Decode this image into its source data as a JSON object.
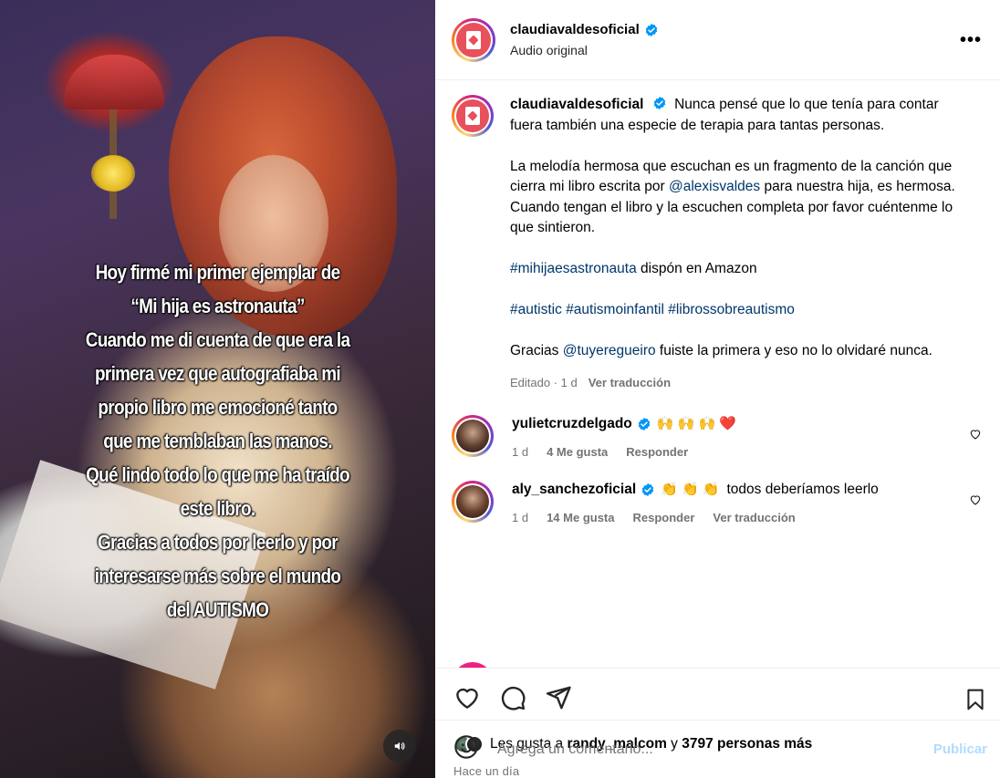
{
  "media": {
    "overlay_text": "Hoy firmé mi primer ejemplar de\n“Mi hija es astronauta”\nCuando me di cuenta de que era la\nprimera vez que autografiaba mi\npropio libro me emocioné tanto\nque me temblaban las manos.\nQué lindo todo lo que me ha traído\neste libro.\nGracias a todos por leerlo y por\ninteresarse más sobre el mundo\ndel AUTISMO",
    "mute_icon": "speaker-icon"
  },
  "header": {
    "username": "claudiavaldesoficial",
    "subtitle": "Audio original",
    "more_icon": "•••"
  },
  "caption": {
    "username": "claudiavaldesoficial",
    "p1": "Nunca pensé que lo que tenía para contar fuera también una especie de terapia para tantas personas.",
    "p2_a": "La melodía hermosa que escuchan es un fragmento de la canción que cierra mi libro escrita por ",
    "p2_mention": "@alexisvaldes",
    "p2_b": " para nuestra hija, es hermosa. Cuando tengan el libro y la escuchen completa por favor cuéntenme lo que sintieron.",
    "p3_tag": "#mihijaesastronauta",
    "p3_rest": " dispón en Amazon",
    "p4_tag1": "#autistic",
    "p4_tag2": "#autismoinfantil",
    "p4_tag3": "#librossobreautismo",
    "p5_a": "Gracias ",
    "p5_mention": "@tuyeregueiro",
    "p5_b": " fuiste la primera y eso no lo olvidaré nunca.",
    "edited": "Editado · 1 d",
    "translate": "Ver traducción"
  },
  "comments": [
    {
      "username": "yulietcruzdelgado",
      "text_emojis": "🙌 🙌 🙌 ❤️",
      "text": "",
      "time": "1 d",
      "likes": "4 Me gusta",
      "reply": "Responder",
      "translate": ""
    },
    {
      "username": "aly_sanchezoficial",
      "text_emojis": "👏 👏 👏",
      "text": "todos deberíamos leerlo",
      "time": "1 d",
      "likes": "14 Me gusta",
      "reply": "Responder",
      "translate": "Ver traducción"
    }
  ],
  "likes": {
    "prefix": "Les gusta a ",
    "user": "randy_malcom",
    "middle": " y ",
    "count": "3797 personas más"
  },
  "posted": "Hace un día",
  "composer": {
    "placeholder": "Agrega un comentario...",
    "post_label": "Publicar"
  },
  "colors": {
    "link": "#00376b",
    "verified": "#0095f6",
    "muted": "#737373",
    "publish_disabled": "#b3dbff"
  }
}
